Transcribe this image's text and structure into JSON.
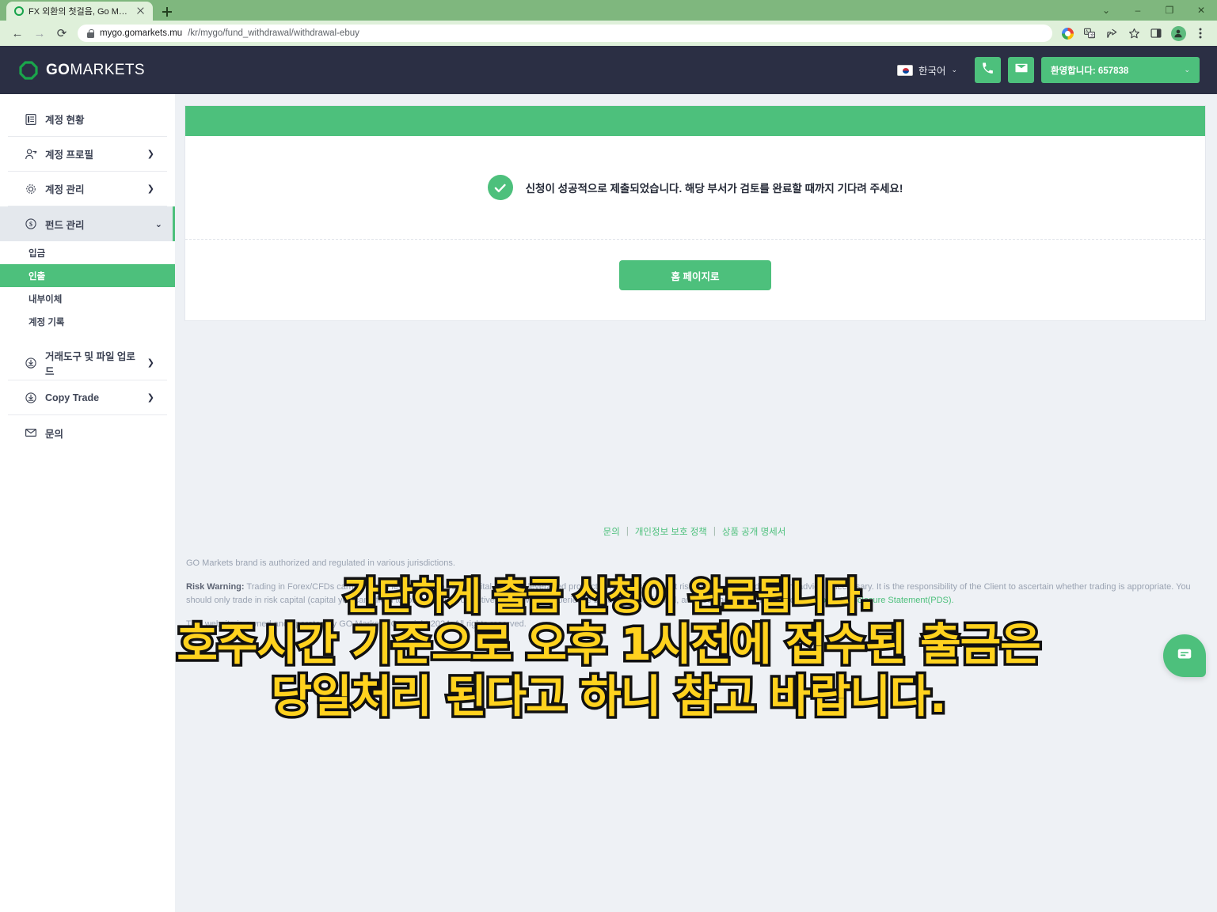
{
  "browser": {
    "tab_title": "FX 외환의 첫걸음, Go Markets",
    "newtab_label": "+",
    "window_controls": {
      "minimize_chrome": "⌄",
      "minimize": "–",
      "maximize": "❐",
      "close": "✕"
    },
    "nav": {
      "back": "←",
      "forward": "→",
      "reload": "⟳"
    },
    "url_domain": "mygo.gomarkets.mu",
    "url_path": "/kr/mygo/fund_withdrawal/withdrawal-ebuy",
    "toolbar_icons": [
      "google-icon",
      "translate-icon",
      "share-icon",
      "bookmark-star-icon",
      "sidepanel-icon",
      "profile-avatar-icon",
      "kebab-menu-icon"
    ]
  },
  "header": {
    "brand_primary": "GO",
    "brand_secondary": "MARKETS",
    "language": "한국어",
    "phone_icon": "phone-icon",
    "mail_icon": "envelope-icon",
    "user_label": "환영합니다: 657838",
    "caret": "⌄"
  },
  "sidebar": {
    "items": [
      {
        "label": "계정 현황",
        "icon": "document-list-icon",
        "arrow": "",
        "state": "normal"
      },
      {
        "label": "계정 프로필",
        "icon": "person-key-icon",
        "arrow": "❯",
        "state": "normal"
      },
      {
        "label": "계정 관리",
        "icon": "gear-icon",
        "arrow": "❯",
        "state": "normal"
      },
      {
        "label": "펀드 관리",
        "icon": "dollar-circle-icon",
        "arrow": "⌄",
        "state": "expanded"
      },
      {
        "label": "거래도구 및 파일 업로드",
        "icon": "download-circle-icon",
        "arrow": "❯",
        "state": "normal"
      },
      {
        "label": "Copy Trade",
        "icon": "download-circle-icon",
        "arrow": "❯",
        "state": "normal"
      },
      {
        "label": "문의",
        "icon": "envelope-icon",
        "arrow": "",
        "state": "normal"
      }
    ],
    "sub_items": [
      {
        "label": "입금",
        "selected": false
      },
      {
        "label": "인출",
        "selected": true
      },
      {
        "label": "내부이체",
        "selected": false
      },
      {
        "label": "계정 기록",
        "selected": false
      }
    ]
  },
  "main": {
    "success_message": "신청이 성공적으로 제출되었습니다. 해당 부서가 검토를 완료할 때까지 기다려 주세요!",
    "check_icon": "check-circle-icon",
    "home_button": "홈 페이지로"
  },
  "footer": {
    "links": [
      "문의",
      "개인정보 보호 정책",
      "상품 공개 명세서"
    ],
    "separator": "|",
    "line1": "GO Markets brand is authorized and regulated in various jurisdictions.",
    "risk_label": "Risk Warning:",
    "risk_body": "Trading in Forex/CFDs carries a high level of risk to your capital. Trading leveraged products involves significant risk of loss. Seek independent advice if necessary. It is the responsibility of the Client to ascertain whether trading is appropriate. You should only trade in risk capital (capital you can afford to lose). Trading objectives and level of experience should be considered, and you should carefully read our",
    "pds_link": "Product Disclosure Statement(PDS).",
    "line3": "This website is owned and operated by GO Markets. Copyright 2024. All rights reserved.",
    "chat_icon": "chat-bubble-icon"
  },
  "overlay_caption": {
    "line1": "간단하게 출금 신청이 완료됩니다.",
    "line2": "호주시간 기준으로 오후 1시전에 접수된 출금은",
    "line3": "당일처리 된다고 하니 참고 바랍니다."
  },
  "colors": {
    "brand_green": "#4dc07c",
    "header_navy": "#2b2f44",
    "page_bg": "#eef1f5",
    "caption_yellow": "#ffd21e"
  }
}
